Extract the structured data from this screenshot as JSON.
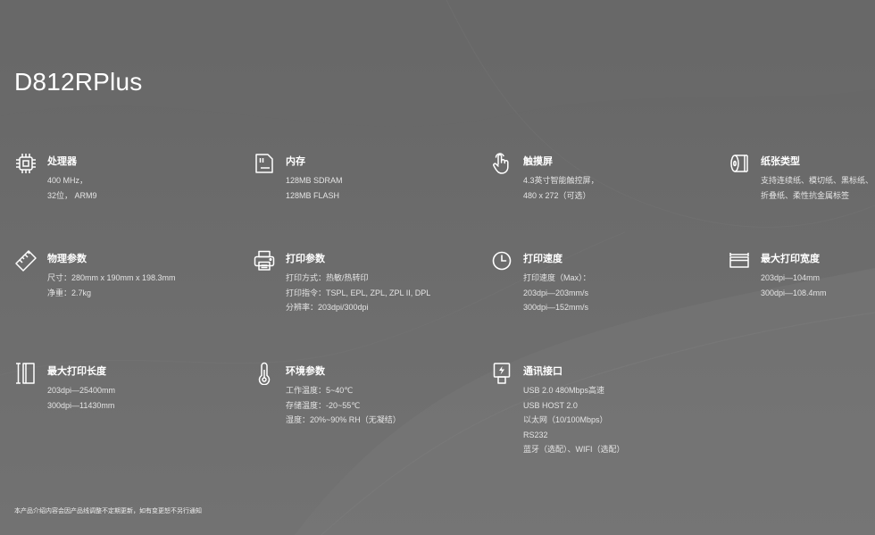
{
  "product": {
    "title": "D812RPlus"
  },
  "specs": [
    {
      "label": "处理器",
      "icon": "cpu-icon",
      "lines": [
        "400 MHz，",
        "32位， ARM9"
      ]
    },
    {
      "label": "内存",
      "icon": "memory-card-icon",
      "lines": [
        "128MB SDRAM",
        "128MB FLASH"
      ]
    },
    {
      "label": "触摸屏",
      "icon": "touch-hand-icon",
      "lines": [
        "4.3英寸智能触控屏，",
        "480 x 272（可选）"
      ]
    },
    {
      "label": "纸张类型",
      "icon": "paper-roll-icon",
      "lines": [
        "支持连续纸、模切纸、黑标纸、",
        "折叠纸、柔性抗金属标签"
      ]
    },
    {
      "label": "物理参数",
      "icon": "ruler-icon",
      "lines": [
        "尺寸：280mm x 190mm x 198.3mm",
        "净重：2.7kg"
      ]
    },
    {
      "label": "打印参数",
      "icon": "printer-icon",
      "lines": [
        "打印方式：热敏/热转印",
        "打印指令：TSPL, EPL, ZPL, ZPL II, DPL",
        "分辨率：203dpi/300dpi"
      ]
    },
    {
      "label": "打印速度",
      "icon": "clock-icon",
      "lines": [
        "打印速度（Max）：",
        "203dpi—203mm/s",
        "300dpi—152mm/s"
      ]
    },
    {
      "label": "最大打印宽度",
      "icon": "print-width-icon",
      "lines": [
        "203dpi—104mm",
        "300dpi—108.4mm"
      ]
    },
    {
      "label": "最大打印长度",
      "icon": "print-length-icon",
      "lines": [
        "203dpi—25400mm",
        "300dpi—11430mm"
      ]
    },
    {
      "label": "环境参数",
      "icon": "thermometer-icon",
      "lines": [
        "工作温度：5~40℃",
        "存储温度：-20~55℃",
        "湿度：20%~90% RH（无凝结）"
      ]
    },
    {
      "label": "通讯接口",
      "icon": "usb-icon",
      "lines": [
        "USB 2.0 480Mbps高速",
        "USB HOST 2.0",
        "以太网（10/100Mbps）",
        "RS232",
        "蓝牙（选配）、WIFI（选配）"
      ]
    }
  ],
  "footnote": "本产品介绍内容会因产品线调整不定期更新，如有变更恕不另行通知"
}
